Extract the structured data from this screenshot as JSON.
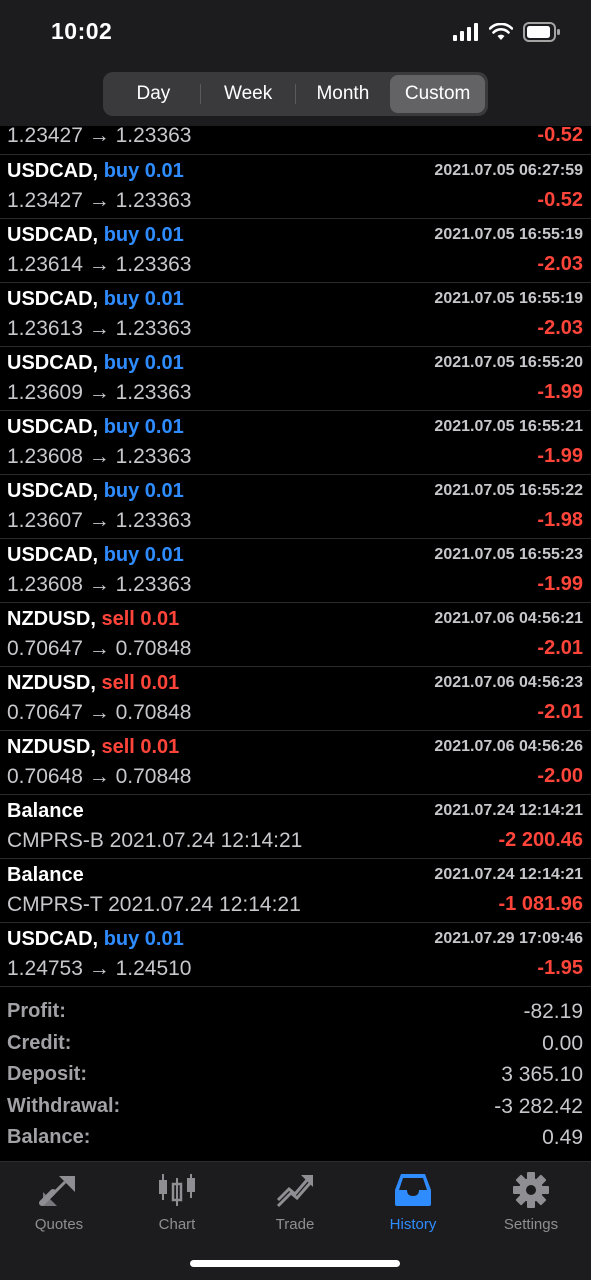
{
  "status_bar": {
    "time": "10:02"
  },
  "period_tabs": [
    {
      "label": "Day"
    },
    {
      "label": "Week"
    },
    {
      "label": "Month"
    },
    {
      "label": "Custom",
      "active": true
    }
  ],
  "partial_row": {
    "prices": "1.23427 → 1.23363",
    "pl": "-0.52"
  },
  "rows": [
    {
      "symbol": "USDCAD,",
      "side": "buy 0.01",
      "side_type": "buy",
      "datetime": "2021.07.05 06:27:59",
      "prices": "1.23427 → 1.23363",
      "pl": "-0.52"
    },
    {
      "symbol": "USDCAD,",
      "side": "buy 0.01",
      "side_type": "buy",
      "datetime": "2021.07.05 16:55:19",
      "prices": "1.23614 → 1.23363",
      "pl": "-2.03"
    },
    {
      "symbol": "USDCAD,",
      "side": "buy 0.01",
      "side_type": "buy",
      "datetime": "2021.07.05 16:55:19",
      "prices": "1.23613 → 1.23363",
      "pl": "-2.03"
    },
    {
      "symbol": "USDCAD,",
      "side": "buy 0.01",
      "side_type": "buy",
      "datetime": "2021.07.05 16:55:20",
      "prices": "1.23609 → 1.23363",
      "pl": "-1.99"
    },
    {
      "symbol": "USDCAD,",
      "side": "buy 0.01",
      "side_type": "buy",
      "datetime": "2021.07.05 16:55:21",
      "prices": "1.23608 → 1.23363",
      "pl": "-1.99"
    },
    {
      "symbol": "USDCAD,",
      "side": "buy 0.01",
      "side_type": "buy",
      "datetime": "2021.07.05 16:55:22",
      "prices": "1.23607 → 1.23363",
      "pl": "-1.98"
    },
    {
      "symbol": "USDCAD,",
      "side": "buy 0.01",
      "side_type": "buy",
      "datetime": "2021.07.05 16:55:23",
      "prices": "1.23608 → 1.23363",
      "pl": "-1.99"
    },
    {
      "symbol": "NZDUSD,",
      "side": "sell 0.01",
      "side_type": "sell",
      "datetime": "2021.07.06 04:56:21",
      "prices": "0.70647 → 0.70848",
      "pl": "-2.01"
    },
    {
      "symbol": "NZDUSD,",
      "side": "sell 0.01",
      "side_type": "sell",
      "datetime": "2021.07.06 04:56:23",
      "prices": "0.70647 → 0.70848",
      "pl": "-2.01"
    },
    {
      "symbol": "NZDUSD,",
      "side": "sell 0.01",
      "side_type": "sell",
      "datetime": "2021.07.06 04:56:26",
      "prices": "0.70648 → 0.70848",
      "pl": "-2.00"
    },
    {
      "symbol": "Balance",
      "side": "",
      "side_type": "none",
      "datetime": "2021.07.24 12:14:21",
      "prices": "CMPRS-B 2021.07.24 12:14:21",
      "pl": "-2 200.46"
    },
    {
      "symbol": "Balance",
      "side": "",
      "side_type": "none",
      "datetime": "2021.07.24 12:14:21",
      "prices": "CMPRS-T 2021.07.24 12:14:21",
      "pl": "-1 081.96"
    },
    {
      "symbol": "USDCAD,",
      "side": "buy 0.01",
      "side_type": "buy",
      "datetime": "2021.07.29 17:09:46",
      "prices": "1.24753 → 1.24510",
      "pl": "-1.95"
    }
  ],
  "summary": [
    {
      "label": "Profit:",
      "value": "-82.19"
    },
    {
      "label": "Credit:",
      "value": "0.00"
    },
    {
      "label": "Deposit:",
      "value": "3 365.10"
    },
    {
      "label": "Withdrawal:",
      "value": "-3 282.42"
    },
    {
      "label": "Balance:",
      "value": "0.49"
    }
  ],
  "tabbar": [
    {
      "label": "Quotes",
      "icon": "quotes-icon"
    },
    {
      "label": "Chart",
      "icon": "chart-icon"
    },
    {
      "label": "Trade",
      "icon": "trade-icon"
    },
    {
      "label": "History",
      "icon": "history-icon",
      "active": true
    },
    {
      "label": "Settings",
      "icon": "settings-icon"
    }
  ],
  "colors": {
    "buy": "#2f8cff",
    "sell": "#ff453a",
    "loss": "#ff453a",
    "active_tab": "#2f8cff"
  }
}
